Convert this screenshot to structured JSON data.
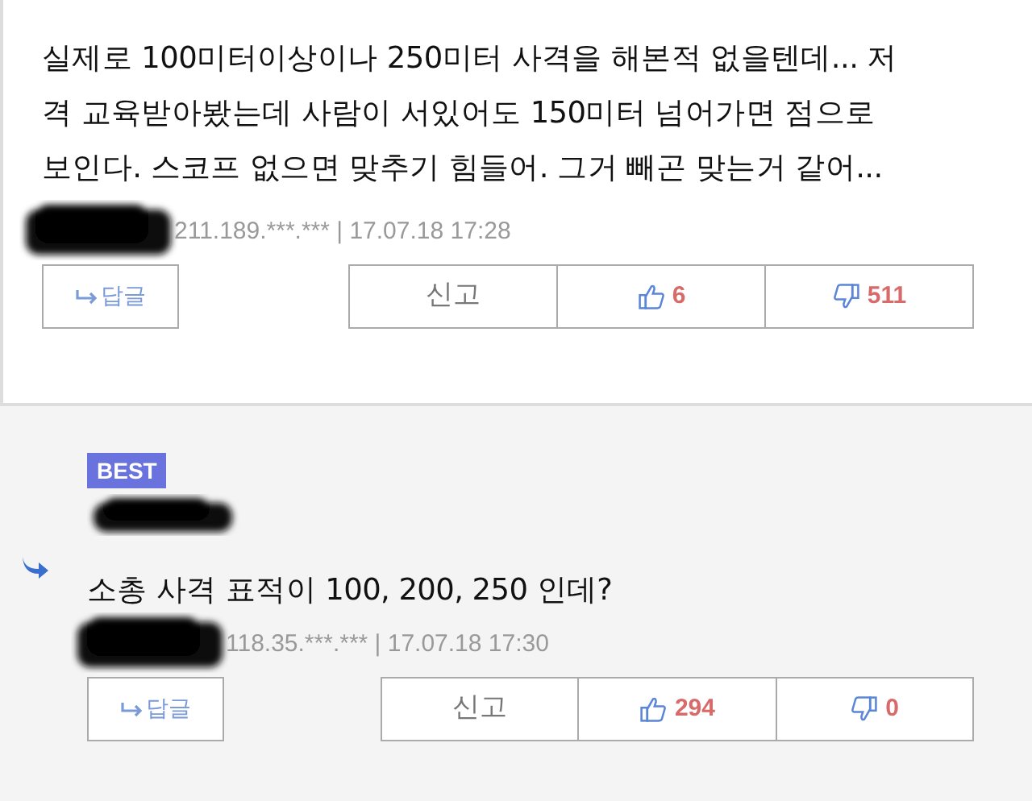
{
  "comments": [
    {
      "best": false,
      "is_reply": false,
      "text": "실제로 100미터이상이나 250미터 사격을 해본적 없을텐데... 저\n격 교육받아봤는데 사람이 서있어도  150미터 넘어가면 점으로\n보인다. 스코프 없으면 맞추기 힘들어. 그거 빼곤 맞는거 같어...",
      "ip": "211.189.***.***",
      "separator": "|",
      "date": "17.07.18 17:28",
      "reply_label": "답글",
      "report_label": "신고",
      "likes": "6",
      "dislikes": "511"
    },
    {
      "best": true,
      "best_label": "BEST",
      "is_reply": true,
      "text": "소총 사격 표적이 100, 200, 250 인데?",
      "ip": "118.35.***.***",
      "separator": "|",
      "date": "17.07.18 17:30",
      "reply_label": "답글",
      "report_label": "신고",
      "likes": "294",
      "dislikes": "0"
    }
  ]
}
